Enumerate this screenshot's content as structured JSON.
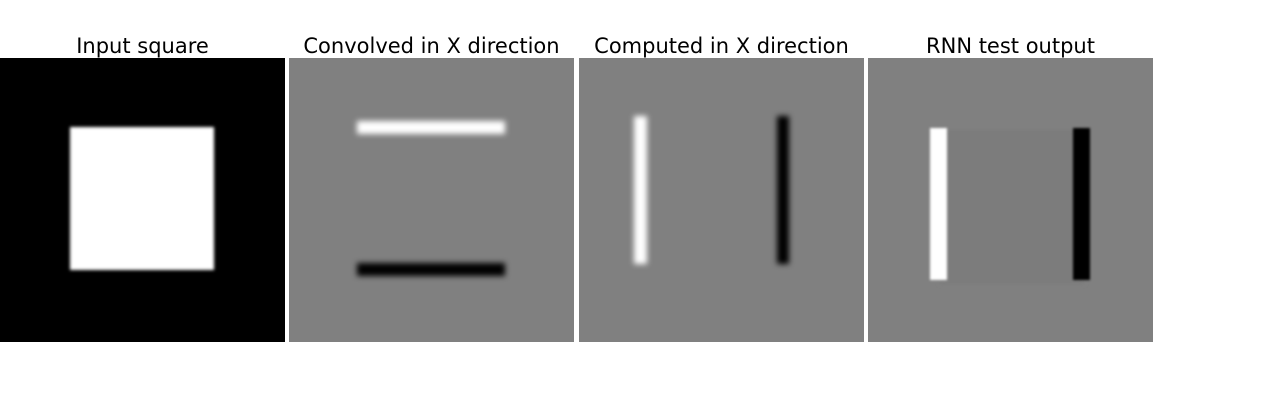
{
  "panels": [
    {
      "title": "Input square",
      "background": "#000000",
      "shape_fill": "#ffffff"
    },
    {
      "title": "Convolved in X direction",
      "background": "#808080",
      "top_edge_fill": "#ffffff",
      "bottom_edge_fill": "#000000"
    },
    {
      "title": "Computed in X direction",
      "background": "#808080",
      "left_edge_fill": "#ffffff",
      "right_edge_fill": "#000000"
    },
    {
      "title": "RNN test output",
      "background": "#808080",
      "left_edge_fill": "#ffffff",
      "right_edge_fill": "#000000",
      "interior_fill": "#7b7b7b"
    }
  ]
}
